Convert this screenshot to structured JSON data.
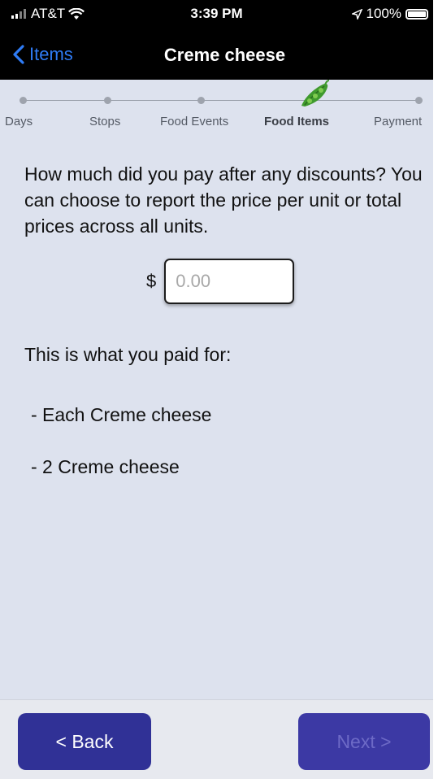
{
  "status_bar": {
    "carrier": "AT&T",
    "time": "3:39 PM",
    "battery": "100%"
  },
  "nav": {
    "back_label": "Items",
    "title": "Creme cheese"
  },
  "steps": [
    {
      "label": "Days"
    },
    {
      "label": "Stops"
    },
    {
      "label": "Food Events"
    },
    {
      "label": "Food Items",
      "active": true
    },
    {
      "label": "Payment"
    }
  ],
  "question": "How much did you pay after any discounts? You can choose to report the price per unit or total prices across all units.",
  "price": {
    "currency": "$",
    "value": "",
    "placeholder": "0.00"
  },
  "paid_for": {
    "heading": "This is what you paid for:",
    "items": [
      "- Each Creme cheese",
      "- 2 Creme cheese"
    ]
  },
  "footer": {
    "back_label": "< Back",
    "next_label": "Next >"
  },
  "colors": {
    "accent": "#303196",
    "link": "#2f7cf6",
    "background": "#dde2ee"
  }
}
